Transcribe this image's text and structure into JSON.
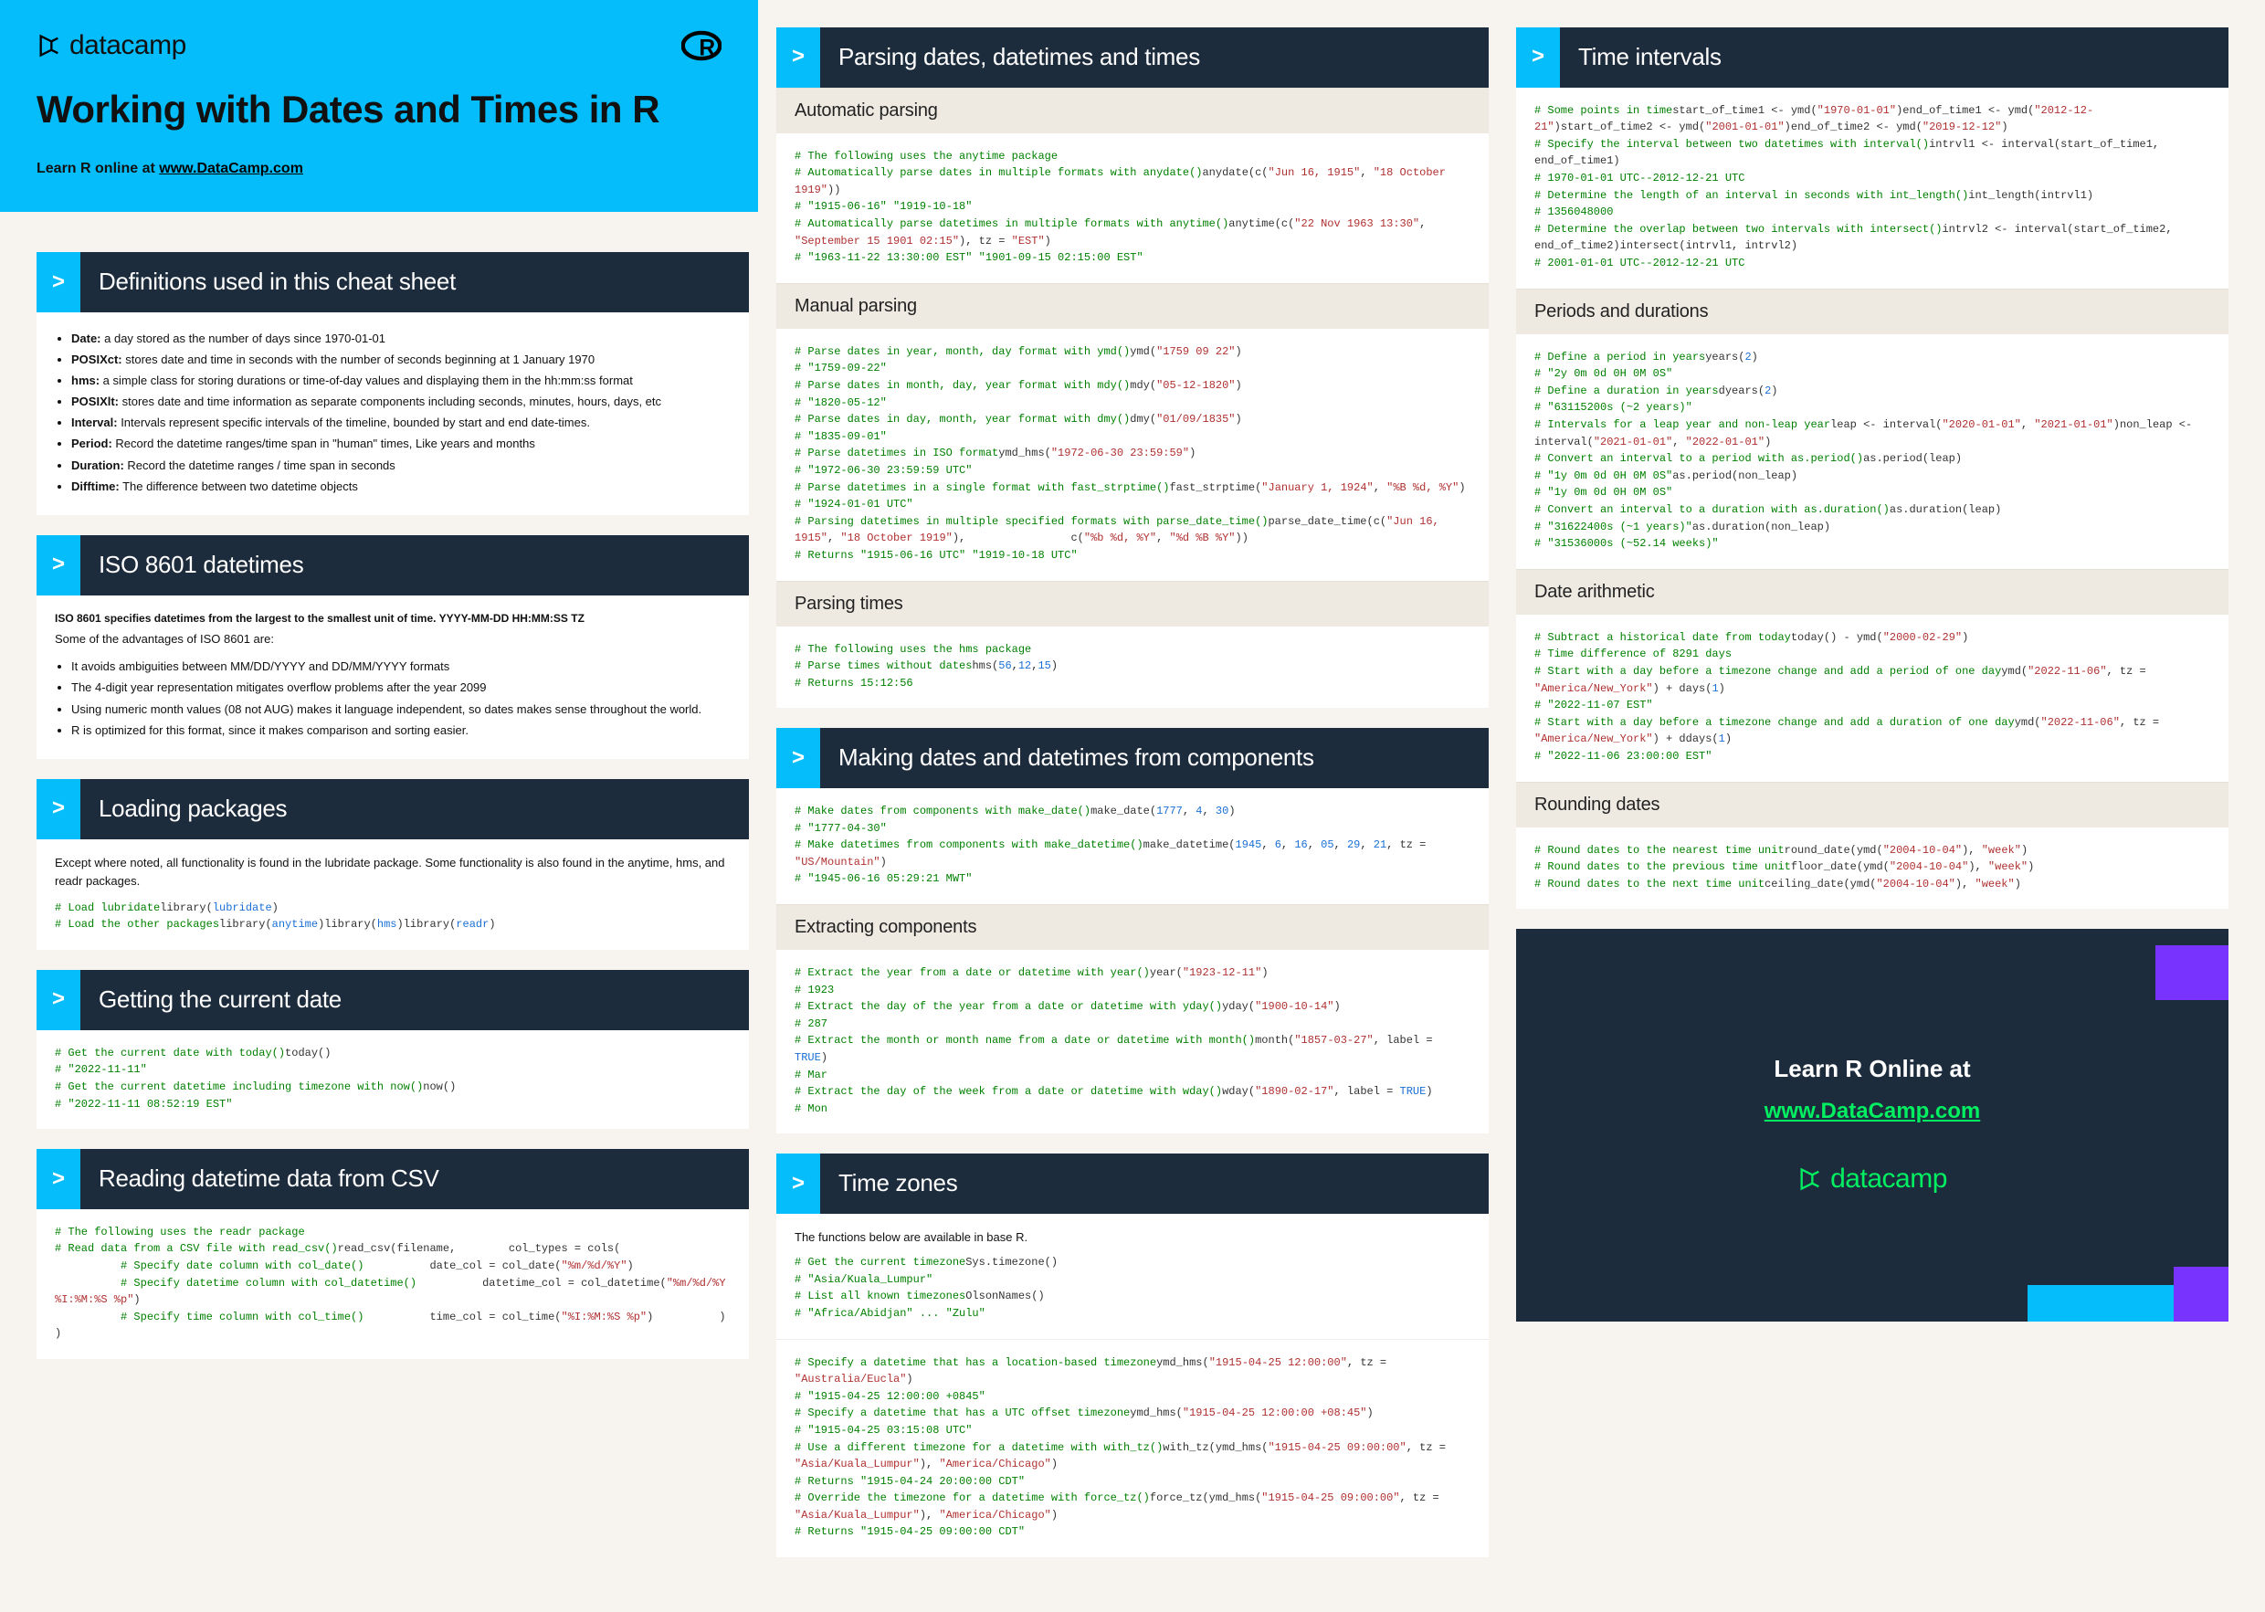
{
  "brand": "datacamp",
  "title": "Working with Dates and Times in R",
  "subtitle_prefix": "Learn R online at ",
  "subtitle_link": "www.DataCamp.com",
  "s_defs": "Definitions used in this cheat sheet",
  "defs": [
    [
      "Date:",
      " a day stored as the number of days since 1970-01-01"
    ],
    [
      "POSIXct:",
      " stores date and time in seconds with the number of seconds beginning at 1 January 1970"
    ],
    [
      "hms:",
      " a simple class for storing durations or time-of-day values and displaying them in the hh:mm:ss format"
    ],
    [
      "POSIXlt:",
      " stores date and time information as separate components including seconds, minutes, hours, days, etc"
    ],
    [
      "Interval:",
      " Intervals represent specific intervals of the timeline, bounded by start and end date-times."
    ],
    [
      "Period:",
      " Record the datetime ranges/time span in \"human\" times, Like years and months"
    ],
    [
      "Duration:",
      " Record the datetime ranges / time span in seconds"
    ],
    [
      "Difftime:",
      " The difference between two datetime objects"
    ]
  ],
  "s_iso": "ISO 8601 datetimes",
  "iso_intro1": "ISO 8601 specifies datetimes from the largest to the smallest unit of time. YYYY-MM-DD HH:MM:SS TZ",
  "iso_intro2": "Some of the advantages of ISO 8601 are:",
  "iso_adv": [
    "It avoids ambiguities between MM/DD/YYYY and DD/MM/YYYY formats",
    "The 4-digit year representation mitigates overflow problems after the year 2099",
    "Using numeric month values (08 not AUG) makes it language independent, so dates makes sense throughout the world.",
    "R is optimized for this format, since it makes comparison and sorting easier."
  ],
  "s_load": "Loading packages",
  "load_intro": "Except where noted, all functionality is found in the lubridate package. Some functionality is also found in the anytime, hms, and readr packages.",
  "code_load": [
    [
      "cmt",
      "# Load lubridate"
    ],
    [
      "fn",
      "library("
    ],
    [
      "kw",
      "lubridate"
    ],
    [
      "fn",
      ")"
    ],
    [
      "",
      ""
    ],
    [
      "cmt",
      "# Load the other packages"
    ],
    [
      "fn",
      "library("
    ],
    [
      "kw",
      "anytime"
    ],
    [
      "fn",
      ")"
    ],
    [
      "fn",
      "library("
    ],
    [
      "kw",
      "hms"
    ],
    [
      "fn",
      ")"
    ],
    [
      "fn",
      "library("
    ],
    [
      "kw",
      "readr"
    ],
    [
      "fn",
      ")"
    ]
  ],
  "s_today": "Getting the current date",
  "code_today": [
    [
      "cmt",
      "# Get the current date with today()"
    ],
    [
      "fn",
      "today() "
    ],
    [
      "cmt",
      "# \"2022-11-11\""
    ],
    [
      "",
      ""
    ],
    [
      "cmt",
      "# Get the current datetime including timezone with now()"
    ],
    [
      "fn",
      "now() "
    ],
    [
      "cmt",
      "# \"2022-11-11 08:52:19 EST\""
    ]
  ],
  "s_csv": "Reading datetime data from CSV",
  "code_csv": [
    [
      "cmt",
      "# The following uses the readr package"
    ],
    [
      "",
      ""
    ],
    [
      "cmt",
      "# Read data from a CSV file with read_csv()"
    ],
    [
      "fn",
      "read_csv(filename,"
    ],
    [
      "fn",
      "        col_types = cols("
    ],
    [
      "cmt",
      "          # Specify date column with col_date()"
    ],
    [
      "fn",
      "          date_col = col_date("
    ],
    [
      "str",
      "\"%m/%d/%Y\""
    ],
    [
      "fn",
      ")"
    ],
    [
      "cmt",
      "          # Specify datetime column with col_datetime()"
    ],
    [
      "fn",
      "          datetime_col = col_datetime("
    ],
    [
      "str",
      "\"%m/%d/%Y %I:%M:%S %p\""
    ],
    [
      "fn",
      ")"
    ],
    [
      "cmt",
      "          # Specify time column with col_time()"
    ],
    [
      "fn",
      "          time_col = col_time("
    ],
    [
      "str",
      "\"%I:%M:%S %p\""
    ],
    [
      "fn",
      ")"
    ],
    [
      "fn",
      "          )"
    ],
    [
      "fn",
      "        )"
    ]
  ],
  "s_parse": "Parsing dates, datetimes and times",
  "sh_auto": "Automatic parsing",
  "code_auto": [
    [
      "cmt",
      "# The following uses the anytime package"
    ],
    [
      "",
      ""
    ],
    [
      "cmt",
      "# Automatically parse dates in multiple formats with anydate()"
    ],
    [
      "fn",
      "anydate(c("
    ],
    [
      "str",
      "\"Jun 16, 1915\""
    ],
    [
      "fn",
      ", "
    ],
    [
      "str",
      "\"18 October 1919\""
    ],
    [
      "fn",
      ")) "
    ],
    [
      "cmt",
      "# \"1915-06-16\" \"1919-10-18\""
    ],
    [
      "",
      ""
    ],
    [
      "cmt",
      "# Automatically parse datetimes in multiple formats with anytime()"
    ],
    [
      "fn",
      "anytime(c("
    ],
    [
      "str",
      "\"22 Nov 1963 13:30\""
    ],
    [
      "fn",
      ", "
    ],
    [
      "str",
      "\"September 15 1901 02:15\""
    ],
    [
      "fn",
      "), tz = "
    ],
    [
      "str",
      "\"EST\""
    ],
    [
      "fn",
      ") "
    ],
    [
      "cmt",
      "# \"1963-11-22 13:30:00 EST\" \"1901-09-15 02:15:00 EST\""
    ]
  ],
  "sh_manual": "Manual parsing",
  "code_manual": [
    [
      "cmt",
      "# Parse dates in year, month, day format with ymd()"
    ],
    [
      "fn",
      "ymd("
    ],
    [
      "str",
      "\"1759 09 22\""
    ],
    [
      "fn",
      ") "
    ],
    [
      "cmt",
      "# \"1759-09-22\""
    ],
    [
      "",
      ""
    ],
    [
      "cmt",
      "# Parse dates in month, day, year format with mdy()"
    ],
    [
      "fn",
      "mdy("
    ],
    [
      "str",
      "\"05-12-1820\""
    ],
    [
      "fn",
      ") "
    ],
    [
      "cmt",
      "# \"1820-05-12\""
    ],
    [
      "",
      ""
    ],
    [
      "cmt",
      "# Parse dates in day, month, year format with dmy()"
    ],
    [
      "fn",
      "dmy("
    ],
    [
      "str",
      "\"01/09/1835\""
    ],
    [
      "fn",
      ") "
    ],
    [
      "cmt",
      "# \"1835-09-01\""
    ],
    [
      "",
      ""
    ],
    [
      "cmt",
      "# Parse datetimes in ISO format"
    ],
    [
      "fn",
      "ymd_hms("
    ],
    [
      "str",
      "\"1972-06-30 23:59:59\""
    ],
    [
      "fn",
      ") "
    ],
    [
      "cmt",
      "# \"1972-06-30 23:59:59 UTC\""
    ],
    [
      "",
      ""
    ],
    [
      "cmt",
      "# Parse datetimes in a single format with fast_strptime()"
    ],
    [
      "fn",
      "fast_strptime("
    ],
    [
      "str",
      "\"January 1, 1924\""
    ],
    [
      "fn",
      ", "
    ],
    [
      "str",
      "\"%B %d, %Y\""
    ],
    [
      "fn",
      ") "
    ],
    [
      "cmt",
      "# \"1924-01-01 UTC\""
    ],
    [
      "",
      ""
    ],
    [
      "cmt",
      "# Parsing datetimes in multiple specified formats with parse_date_time()"
    ],
    [
      "fn",
      "parse_date_time(c("
    ],
    [
      "str",
      "\"Jun 16, 1915\""
    ],
    [
      "fn",
      ", "
    ],
    [
      "str",
      "\"18 October 1919\""
    ],
    [
      "fn",
      "),"
    ],
    [
      "fn",
      "                c("
    ],
    [
      "str",
      "\"%b %d, %Y\""
    ],
    [
      "fn",
      ", "
    ],
    [
      "str",
      "\"%d %B %Y\""
    ],
    [
      "fn",
      ")) "
    ],
    [
      "cmt",
      "# Returns \"1915-06-16 UTC\" \"1919-10-18 UTC\""
    ]
  ],
  "sh_ptimes": "Parsing times",
  "code_ptimes": [
    [
      "cmt",
      "# The following uses the hms package"
    ],
    [
      "",
      ""
    ],
    [
      "cmt",
      "# Parse times without dates"
    ],
    [
      "fn",
      "hms("
    ],
    [
      "num",
      "56"
    ],
    [
      "fn",
      ","
    ],
    [
      "num",
      "12"
    ],
    [
      "fn",
      ","
    ],
    [
      "num",
      "15"
    ],
    [
      "fn",
      ") "
    ],
    [
      "cmt",
      "# Returns 15:12:56"
    ]
  ],
  "s_make": "Making dates and datetimes from components",
  "code_make": [
    [
      "cmt",
      "# Make dates from components with make_date()"
    ],
    [
      "fn",
      "make_date("
    ],
    [
      "num",
      "1777"
    ],
    [
      "fn",
      ", "
    ],
    [
      "num",
      "4"
    ],
    [
      "fn",
      ", "
    ],
    [
      "num",
      "30"
    ],
    [
      "fn",
      ") "
    ],
    [
      "cmt",
      "# \"1777-04-30\""
    ],
    [
      "",
      ""
    ],
    [
      "cmt",
      "# Make datetimes from components with make_datetime()"
    ],
    [
      "fn",
      "make_datetime("
    ],
    [
      "num",
      "1945"
    ],
    [
      "fn",
      ", "
    ],
    [
      "num",
      "6"
    ],
    [
      "fn",
      ", "
    ],
    [
      "num",
      "16"
    ],
    [
      "fn",
      ", "
    ],
    [
      "num",
      "05"
    ],
    [
      "fn",
      ", "
    ],
    [
      "num",
      "29"
    ],
    [
      "fn",
      ", "
    ],
    [
      "num",
      "21"
    ],
    [
      "fn",
      ", tz = "
    ],
    [
      "str",
      "\"US/Mountain\""
    ],
    [
      "fn",
      ") "
    ],
    [
      "cmt",
      "# \"1945-06-16 05:29:21 MWT\""
    ]
  ],
  "sh_extract": "Extracting components",
  "code_extract": [
    [
      "cmt",
      "# Extract the year from a date or datetime with year()"
    ],
    [
      "fn",
      "year("
    ],
    [
      "str",
      "\"1923-12-11\""
    ],
    [
      "fn",
      ") "
    ],
    [
      "cmt",
      "# 1923"
    ],
    [
      "",
      ""
    ],
    [
      "cmt",
      "# Extract the day of the year from a date or datetime with yday()"
    ],
    [
      "fn",
      "yday("
    ],
    [
      "str",
      "\"1900-10-14\""
    ],
    [
      "fn",
      ") "
    ],
    [
      "cmt",
      "# 287"
    ],
    [
      "",
      ""
    ],
    [
      "cmt",
      "# Extract the month or month name from a date or datetime with month()"
    ],
    [
      "fn",
      "month("
    ],
    [
      "str",
      "\"1857-03-27\""
    ],
    [
      "fn",
      ", label = "
    ],
    [
      "kw",
      "TRUE"
    ],
    [
      "fn",
      ") "
    ],
    [
      "cmt",
      "# Mar"
    ],
    [
      "",
      ""
    ],
    [
      "cmt",
      "# Extract the day of the week from a date or datetime with wday()"
    ],
    [
      "fn",
      "wday("
    ],
    [
      "str",
      "\"1890-02-17\""
    ],
    [
      "fn",
      ", label = "
    ],
    [
      "kw",
      "TRUE"
    ],
    [
      "fn",
      ") "
    ],
    [
      "cmt",
      "# Mon"
    ]
  ],
  "s_tz": "Time zones",
  "tz_intro": "The functions below are available in base R.",
  "code_tz1": [
    [
      "cmt",
      "# Get the current timezone"
    ],
    [
      "fn",
      "Sys.timezone() "
    ],
    [
      "cmt",
      "# \"Asia/Kuala_Lumpur\""
    ],
    [
      "",
      ""
    ],
    [
      "cmt",
      "# List all known timezones"
    ],
    [
      "fn",
      "OlsonNames() "
    ],
    [
      "cmt",
      "# \"Africa/Abidjan\" ... \"Zulu\""
    ]
  ],
  "code_tz2": [
    [
      "cmt",
      "# Specify a datetime that has a location-based timezone"
    ],
    [
      "fn",
      "ymd_hms("
    ],
    [
      "str",
      "\"1915-04-25 12:00:00\""
    ],
    [
      "fn",
      ", tz = "
    ],
    [
      "str",
      "\"Australia/Eucla\""
    ],
    [
      "fn",
      ") "
    ],
    [
      "cmt",
      "# \"1915-04-25 12:00:00 +0845\""
    ],
    [
      "",
      ""
    ],
    [
      "cmt",
      "# Specify a datetime that has a UTC offset timezone"
    ],
    [
      "fn",
      "ymd_hms("
    ],
    [
      "str",
      "\"1915-04-25 12:00:00 +08:45\""
    ],
    [
      "fn",
      ") "
    ],
    [
      "cmt",
      "# \"1915-04-25 03:15:08 UTC\""
    ],
    [
      "",
      ""
    ],
    [
      "cmt",
      "# Use a different timezone for a datetime with with_tz()"
    ],
    [
      "fn",
      "with_tz(ymd_hms("
    ],
    [
      "str",
      "\"1915-04-25 09:00:00\""
    ],
    [
      "fn",
      ", tz = "
    ],
    [
      "str",
      "\"Asia/Kuala_Lumpur\""
    ],
    [
      "fn",
      "), "
    ],
    [
      "str",
      "\"America/Chicago\""
    ],
    [
      "fn",
      ")"
    ],
    [
      "cmt",
      "# Returns \"1915-04-24 20:00:00 CDT\""
    ],
    [
      "",
      ""
    ],
    [
      "cmt",
      "# Override the timezone for a datetime with force_tz()"
    ],
    [
      "fn",
      "force_tz(ymd_hms("
    ],
    [
      "str",
      "\"1915-04-25 09:00:00\""
    ],
    [
      "fn",
      ", tz = "
    ],
    [
      "str",
      "\"Asia/Kuala_Lumpur\""
    ],
    [
      "fn",
      "), "
    ],
    [
      "str",
      "\"America/Chicago\""
    ],
    [
      "fn",
      ")"
    ],
    [
      "cmt",
      "# Returns \"1915-04-25 09:00:00 CDT\""
    ]
  ],
  "s_intv": "Time intervals",
  "code_intv": [
    [
      "cmt",
      "# Some points in time"
    ],
    [
      "fn",
      "start_of_time1 <- ymd("
    ],
    [
      "str",
      "\"1970-01-01\""
    ],
    [
      "fn",
      ")"
    ],
    [
      "fn",
      "end_of_time1 <- ymd("
    ],
    [
      "str",
      "\"2012-12-21\""
    ],
    [
      "fn",
      ")"
    ],
    [
      "fn",
      "start_of_time2 <- ymd("
    ],
    [
      "str",
      "\"2001-01-01\""
    ],
    [
      "fn",
      ")"
    ],
    [
      "fn",
      "end_of_time2 <- ymd("
    ],
    [
      "str",
      "\"2019-12-12\""
    ],
    [
      "fn",
      ")"
    ],
    [
      "",
      ""
    ],
    [
      "cmt",
      "# Specify the interval between two datetimes with interval()"
    ],
    [
      "fn",
      "intrvl1 <- interval(start_of_time1, end_of_time1) "
    ],
    [
      "cmt",
      "# 1970-01-01 UTC--2012-12-21 UTC"
    ],
    [
      "",
      ""
    ],
    [
      "cmt",
      "# Determine the length of an interval in seconds with int_length()"
    ],
    [
      "fn",
      "int_length(intrvl1) "
    ],
    [
      "cmt",
      "# 1356048000"
    ],
    [
      "",
      ""
    ],
    [
      "cmt",
      "# Determine the overlap between two intervals with intersect()"
    ],
    [
      "fn",
      "intrvl2 <- interval(start_of_time2, end_of_time2)"
    ],
    [
      "fn",
      "intersect(intrvl1, intrvl2) "
    ],
    [
      "cmt",
      "# 2001-01-01 UTC--2012-12-21 UTC"
    ]
  ],
  "sh_per": "Periods and durations",
  "code_per": [
    [
      "cmt",
      "# Define a period in years"
    ],
    [
      "fn",
      "years("
    ],
    [
      "num",
      "2"
    ],
    [
      "fn",
      ") "
    ],
    [
      "cmt",
      "# \"2y 0m 0d 0H 0M 0S\""
    ],
    [
      "",
      ""
    ],
    [
      "cmt",
      "# Define a duration in years"
    ],
    [
      "fn",
      "dyears("
    ],
    [
      "num",
      "2"
    ],
    [
      "fn",
      ") "
    ],
    [
      "cmt",
      "# \"63115200s (~2 years)\""
    ],
    [
      "",
      ""
    ],
    [
      "cmt",
      "# Intervals for a leap year and non-leap year"
    ],
    [
      "fn",
      "leap <- interval("
    ],
    [
      "str",
      "\"2020-01-01\""
    ],
    [
      "fn",
      ", "
    ],
    [
      "str",
      "\"2021-01-01\""
    ],
    [
      "fn",
      ")"
    ],
    [
      "fn",
      "non_leap <- interval("
    ],
    [
      "str",
      "\"2021-01-01\""
    ],
    [
      "fn",
      ", "
    ],
    [
      "str",
      "\"2022-01-01\""
    ],
    [
      "fn",
      ")"
    ],
    [
      "",
      ""
    ],
    [
      "cmt",
      "# Convert an interval to a period with as.period()"
    ],
    [
      "fn",
      "as.period(leap) "
    ],
    [
      "cmt",
      "# \"1y 0m 0d 0H 0M 0S\""
    ],
    [
      "fn",
      "as.period(non_leap) "
    ],
    [
      "cmt",
      "# \"1y 0m 0d 0H 0M 0S\""
    ],
    [
      "",
      ""
    ],
    [
      "cmt",
      "# Convert an interval to a duration with as.duration()"
    ],
    [
      "fn",
      "as.duration(leap) "
    ],
    [
      "cmt",
      "# \"31622400s (~1 years)\""
    ],
    [
      "fn",
      "as.duration(non_leap) "
    ],
    [
      "cmt",
      "# \"31536000s (~52.14 weeks)\""
    ]
  ],
  "sh_arith": "Date arithmetic",
  "code_arith": [
    [
      "cmt",
      "# Subtract a historical date from today"
    ],
    [
      "fn",
      "today() - ymd("
    ],
    [
      "str",
      "\"2000-02-29\""
    ],
    [
      "fn",
      ") "
    ],
    [
      "cmt",
      "# Time difference of 8291 days"
    ],
    [
      "",
      ""
    ],
    [
      "cmt",
      "# Start with a day before a timezone change and add a period of one day"
    ],
    [
      "fn",
      "ymd("
    ],
    [
      "str",
      "\"2022-11-06\""
    ],
    [
      "fn",
      ", tz = "
    ],
    [
      "str",
      "\"America/New_York\""
    ],
    [
      "fn",
      ") + days("
    ],
    [
      "num",
      "1"
    ],
    [
      "fn",
      ") "
    ],
    [
      "cmt",
      "# \"2022-11-07 EST\""
    ],
    [
      "",
      ""
    ],
    [
      "cmt",
      "# Start with a day before a timezone change and add a duration of one day"
    ],
    [
      "fn",
      "ymd("
    ],
    [
      "str",
      "\"2022-11-06\""
    ],
    [
      "fn",
      ", tz = "
    ],
    [
      "str",
      "\"America/New_York\""
    ],
    [
      "fn",
      ") + ddays("
    ],
    [
      "num",
      "1"
    ],
    [
      "fn",
      ") "
    ],
    [
      "cmt",
      "# \"2022-11-06 23:00:00 EST\""
    ]
  ],
  "sh_round": "Rounding dates",
  "code_round": [
    [
      "cmt",
      "# Round dates to the nearest time unit"
    ],
    [
      "fn",
      "round_date(ymd("
    ],
    [
      "str",
      "\"2004-10-04\""
    ],
    [
      "fn",
      "), "
    ],
    [
      "str",
      "\"week\""
    ],
    [
      "fn",
      ")"
    ],
    [
      "",
      ""
    ],
    [
      "cmt",
      "# Round dates to the previous time unit"
    ],
    [
      "fn",
      "floor_date(ymd("
    ],
    [
      "str",
      "\"2004-10-04\""
    ],
    [
      "fn",
      "), "
    ],
    [
      "str",
      "\"week\""
    ],
    [
      "fn",
      ")"
    ],
    [
      "",
      ""
    ],
    [
      "cmt",
      "# Round dates to the next time unit"
    ],
    [
      "fn",
      "ceiling_date(ymd("
    ],
    [
      "str",
      "\"2004-10-04\""
    ],
    [
      "fn",
      "), "
    ],
    [
      "str",
      "\"week\""
    ],
    [
      "fn",
      ")"
    ]
  ],
  "promo_h": "Learn R Online at",
  "promo_link": "www.DataCamp.com"
}
